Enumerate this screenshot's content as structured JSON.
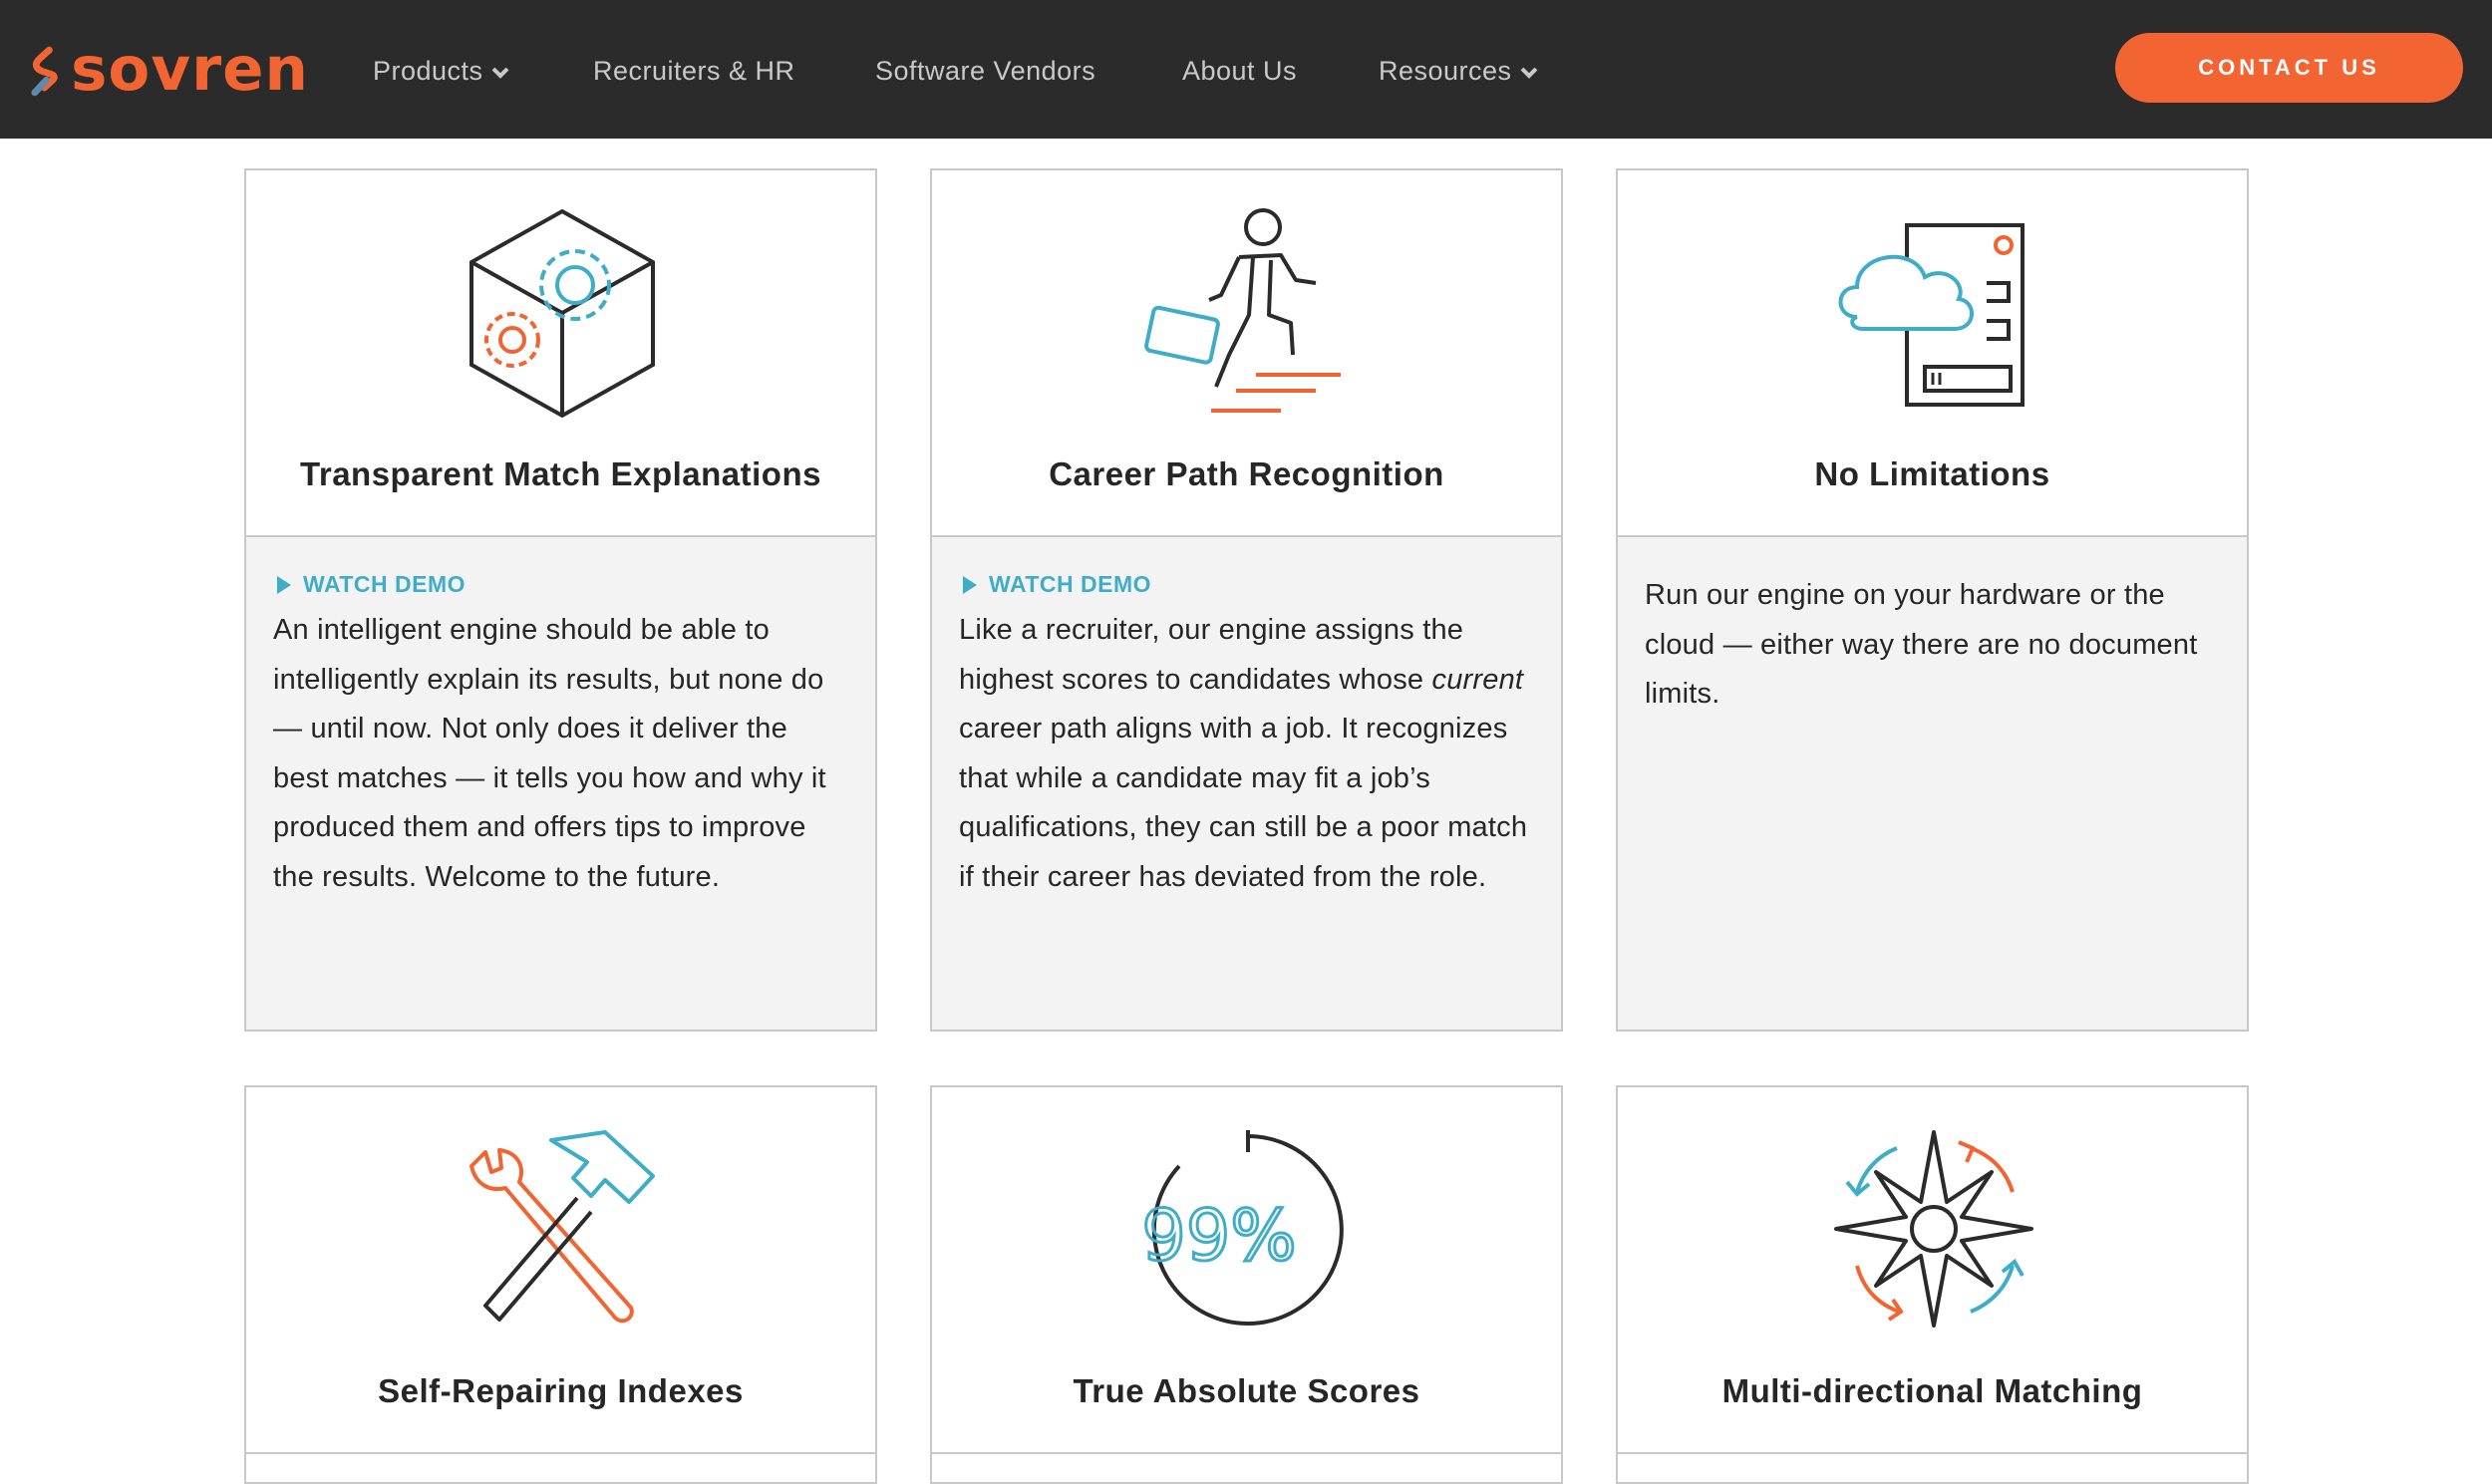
{
  "header": {
    "brand": "sovren",
    "nav": [
      {
        "label": "Products",
        "dropdown": true
      },
      {
        "label": "Recruiters & HR",
        "dropdown": false
      },
      {
        "label": "Software Vendors",
        "dropdown": false
      },
      {
        "label": "About Us",
        "dropdown": false
      },
      {
        "label": "Resources",
        "dropdown": true
      }
    ],
    "contact_label": "CONTACT US"
  },
  "colors": {
    "header_bg": "#2b2b2b",
    "accent_orange": "#f26532",
    "accent_blue": "#3fadc8",
    "card_body_bg": "#f3f3f3"
  },
  "features": [
    {
      "icon": "gear-cube-icon",
      "title": "Transparent Match Explanations",
      "watch_label": "WATCH DEMO",
      "description": "An intelligent engine should be able to intelligently explain its results, but none do — until now. Not only does it deliver the best matches — it tells you how and why it produced them and offers tips to improve the results. Welcome to the future."
    },
    {
      "icon": "walking-businessman-icon",
      "title": "Career Path Recognition",
      "watch_label": "WATCH DEMO",
      "description_pre": "Like a recruiter, our engine assigns the highest scores to candidates whose",
      "description_em": "current",
      "description_post": "career path aligns with a job. It recognizes that while a candidate may fit a job’s qualifications, they can still be a poor match if their career has deviated from the role."
    },
    {
      "icon": "cloud-server-icon",
      "title": "No Limitations",
      "description": "Run our engine on your hardware or the cloud — either way there are no document limits."
    },
    {
      "icon": "hammer-wrench-icon",
      "title": "Self-Repairing Indexes"
    },
    {
      "icon": "percentage-dial-icon",
      "title": "True Absolute Scores",
      "icon_text": "99%"
    },
    {
      "icon": "compass-arrows-icon",
      "title": "Multi-directional Matching"
    }
  ]
}
